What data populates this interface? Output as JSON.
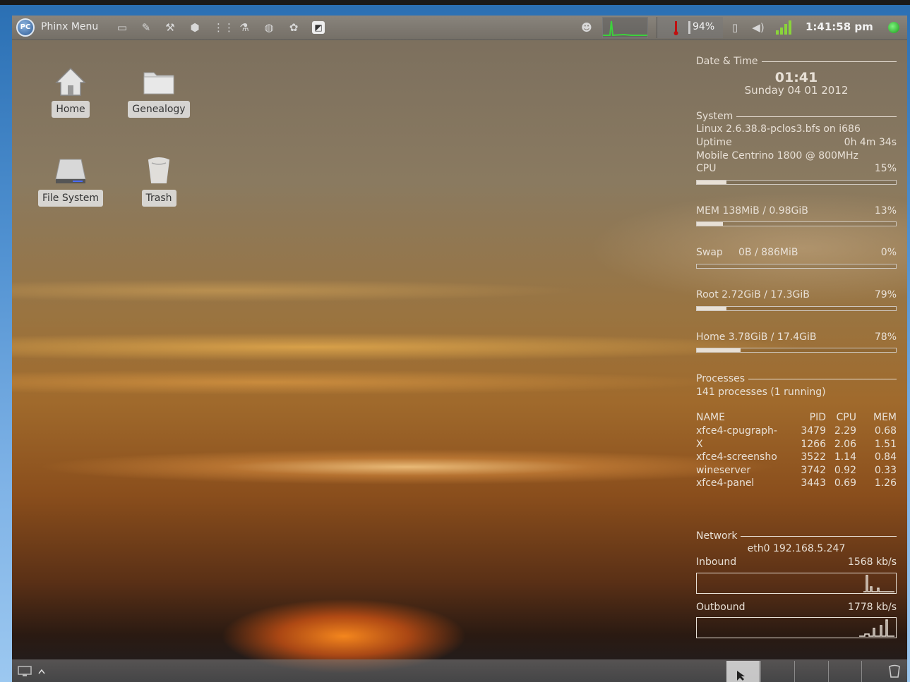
{
  "top_panel": {
    "menu_label": "Phinx Menu",
    "launchers": [
      "terminal-icon",
      "pen-icon",
      "tools-icon",
      "package-icon",
      "grid-icon",
      "flask-icon",
      "disc-icon",
      "wine-icon",
      "screenshot-icon"
    ],
    "battery_percent_label": "94%",
    "clock": "1:41:58 pm"
  },
  "desktop_icons": [
    {
      "label": "Home",
      "icon": "home-icon"
    },
    {
      "label": "Genealogy",
      "icon": "folder-icon"
    },
    {
      "label": "File System",
      "icon": "drive-icon"
    },
    {
      "label": "Trash",
      "icon": "trash-icon"
    }
  ],
  "conky": {
    "datetime_title": "Date & Time",
    "time": "01:41",
    "date": "Sunday 04 01 2012",
    "system_title": "System",
    "kernel": "Linux 2.6.38.8-pclos3.bfs on i686",
    "uptime_label": "Uptime",
    "uptime_value": "0h 4m 34s",
    "cpu_model": "Mobile Centrino 1800 @  800MHz",
    "cpu_label": "CPU",
    "cpu_pct": "15%",
    "cpu_fill": 0.15,
    "mem_label": "MEM  138MiB / 0.98GiB",
    "mem_pct": "13%",
    "mem_fill": 0.13,
    "swap_label": "Swap     0B / 886MiB",
    "swap_pct": "0%",
    "swap_fill": 0,
    "root_label": "Root  2.72GiB / 17.3GiB",
    "root_pct": "79%",
    "root_fill": 0.15,
    "home_label": "Home  3.78GiB / 17.4GiB",
    "home_pct": "78%",
    "home_fill": 0.22,
    "processes_title": "Processes",
    "processes_summary": "141 processes (1 running)",
    "proc_header": [
      "NAME",
      "PID",
      "CPU",
      "MEM"
    ],
    "procs": [
      [
        "xfce4-cpugraph-",
        "3479",
        "2.29",
        "0.68"
      ],
      [
        "X",
        "1266",
        "2.06",
        "1.51"
      ],
      [
        "xfce4-screensho",
        "3522",
        "1.14",
        "0.84"
      ],
      [
        "wineserver",
        "3742",
        "0.92",
        "0.33"
      ],
      [
        "xfce4-panel",
        "3443",
        "0.69",
        "1.26"
      ]
    ],
    "network_title": "Network",
    "eth": "eth0 192.168.5.247",
    "inbound_label": "Inbound",
    "inbound_value": "1568 kb/s",
    "outbound_label": "Outbound",
    "outbound_value": "1778 kb/s"
  }
}
